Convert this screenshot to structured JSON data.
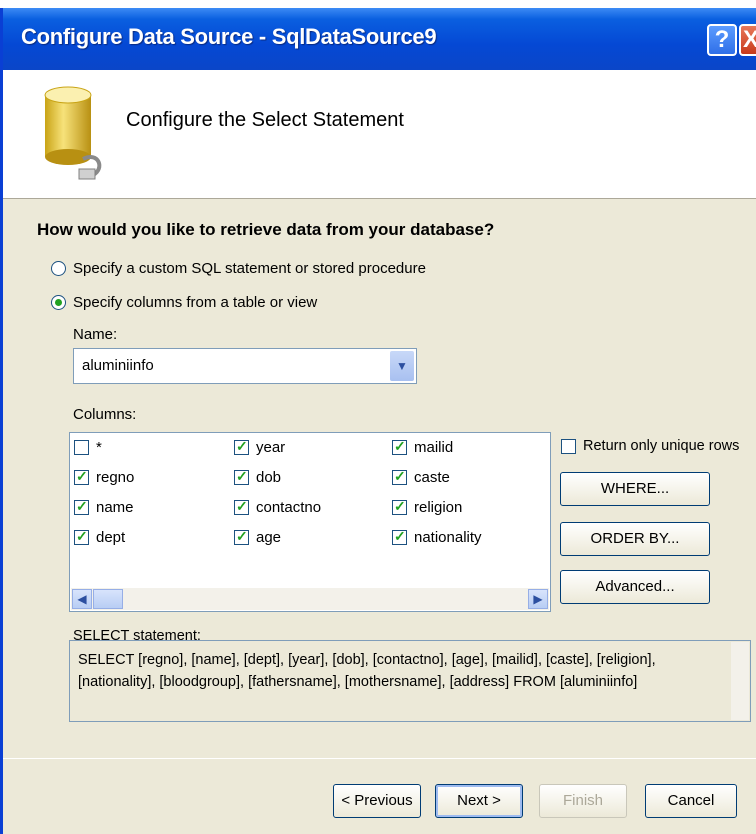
{
  "window": {
    "title": "Configure Data Source - SqlDataSource9",
    "help_label": "?",
    "close_label": "X"
  },
  "header": {
    "title": "Configure the Select Statement",
    "icon": "database-icon"
  },
  "question": "How would you like to retrieve data from your database?",
  "options": {
    "custom_sql": {
      "label": "Specify a custom SQL statement or stored procedure",
      "selected": false
    },
    "columns": {
      "label": "Specify columns from a table or view",
      "selected": true
    }
  },
  "name": {
    "label": "Name:",
    "value": "aluminiinfo"
  },
  "columns": {
    "label": "Columns:",
    "items": [
      {
        "label": "*",
        "checked": false
      },
      {
        "label": "regno",
        "checked": true
      },
      {
        "label": "name",
        "checked": true
      },
      {
        "label": "dept",
        "checked": true
      },
      {
        "label": "year",
        "checked": true
      },
      {
        "label": "dob",
        "checked": true
      },
      {
        "label": "contactno",
        "checked": true
      },
      {
        "label": "age",
        "checked": true
      },
      {
        "label": "mailid",
        "checked": true
      },
      {
        "label": "caste",
        "checked": true
      },
      {
        "label": "religion",
        "checked": true
      },
      {
        "label": "nationality",
        "checked": true
      }
    ]
  },
  "unique_rows": {
    "label": "Return only unique rows",
    "checked": false
  },
  "side_buttons": {
    "where": "WHERE...",
    "order_by": "ORDER BY...",
    "advanced": "Advanced..."
  },
  "select_statement": {
    "label": "SELECT statement:",
    "line1": "SELECT [regno], [name], [dept], [year], [dob], [contactno], [age], [mailid], [caste], [religion],",
    "line2": "[nationality], [bloodgroup], [fathersname], [mothersname], [address] FROM [aluminiinfo]"
  },
  "footer": {
    "previous": "< Previous",
    "next": "Next >",
    "finish": "Finish",
    "cancel": "Cancel"
  }
}
